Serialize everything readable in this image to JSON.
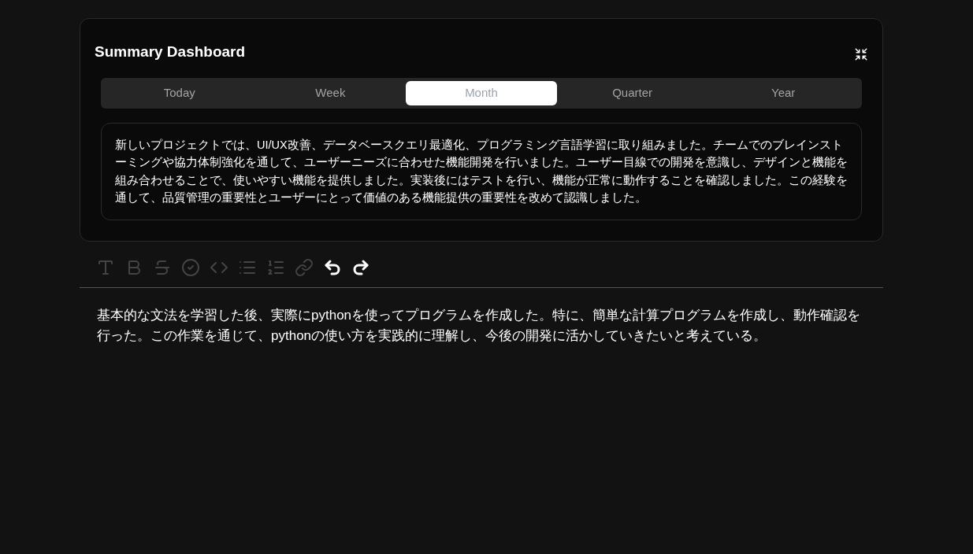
{
  "card": {
    "title": "Summary Dashboard",
    "tabs": [
      {
        "label": "Today",
        "selected": false
      },
      {
        "label": "Week",
        "selected": false
      },
      {
        "label": "Month",
        "selected": true
      },
      {
        "label": "Quarter",
        "selected": false
      },
      {
        "label": "Year",
        "selected": false
      }
    ],
    "summary": "新しいプロジェクトでは、UI/UX改善、データベースクエリ最適化、プログラミング言語学習に取り組みました。チームでのブレインストーミングや協力体制強化を通して、ユーザーニーズに合わせた機能開発を行いました。ユーザー目線での開発を意識し、デザインと機能を組み合わせることで、使いやすい機能を提供しました。実装後にはテストを行い、機能が正常に動作することを確認しました。この経験を通して、品質管理の重要性とユーザーにとって価値のある機能提供の重要性を改めて認識しました。"
  },
  "toolbar": [
    {
      "kind": "heading",
      "disabled": true
    },
    {
      "kind": "bold",
      "disabled": true
    },
    {
      "kind": "strike",
      "disabled": true
    },
    {
      "kind": "check",
      "disabled": true
    },
    {
      "kind": "code",
      "disabled": true
    },
    {
      "kind": "bullet",
      "disabled": true
    },
    {
      "kind": "ordered",
      "disabled": true
    },
    {
      "kind": "link",
      "disabled": true
    },
    {
      "kind": "undo",
      "disabled": false
    },
    {
      "kind": "redo",
      "disabled": false
    }
  ],
  "editor": {
    "text": "基本的な文法を学習した後、実際にpythonを使ってプログラムを作成した。特に、簡単な計算プログラムを作成し、動作確認を行った。この作業を通じて、pythonの使い方を実践的に理解し、今後の開発に活かしていきたいと考えている。"
  }
}
